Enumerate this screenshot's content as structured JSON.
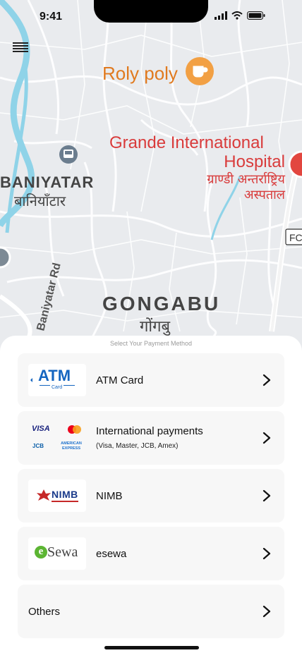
{
  "status_bar": {
    "time": "9:41"
  },
  "map": {
    "labels": {
      "roly_poly": "Roly poly",
      "hospital_line1": "Grande International",
      "hospital_line2": "Hospital",
      "hospital_np_line1": "ग्राण्डी अन्तर्राष्ट्रिय",
      "hospital_np_line2": "अस्पताल",
      "baniyatar": "BANIYATAR",
      "baniyatar_np": "बानियाँटार",
      "baniyatar_rd": "Baniyatar Rd",
      "gongabu": "GONGABU",
      "gongabu_np": "गोंगबु",
      "edge_label": "FC"
    }
  },
  "payment_sheet": {
    "title": "Select Your Payment Method",
    "methods": [
      {
        "label": "ATM Card",
        "logo_text": "ATM",
        "logo_sub": "Card"
      },
      {
        "label": "International payments",
        "sublabel": "(Visa, Master, JCB, Amex)",
        "logo_visa": "VISA",
        "logo_jcb": "JCB",
        "logo_amex1": "AMERICAN",
        "logo_amex2": "EXPRESS"
      },
      {
        "label": "NIMB",
        "logo_text": "NIMB"
      },
      {
        "label": "esewa",
        "logo_e": "e",
        "logo_rest": "Sewa"
      },
      {
        "label": "Others"
      }
    ]
  },
  "colors": {
    "accent_atm": "#1565c0",
    "hospital": "#d93b3b",
    "cafe": "#e07a1f",
    "river": "#8fd3e8"
  }
}
